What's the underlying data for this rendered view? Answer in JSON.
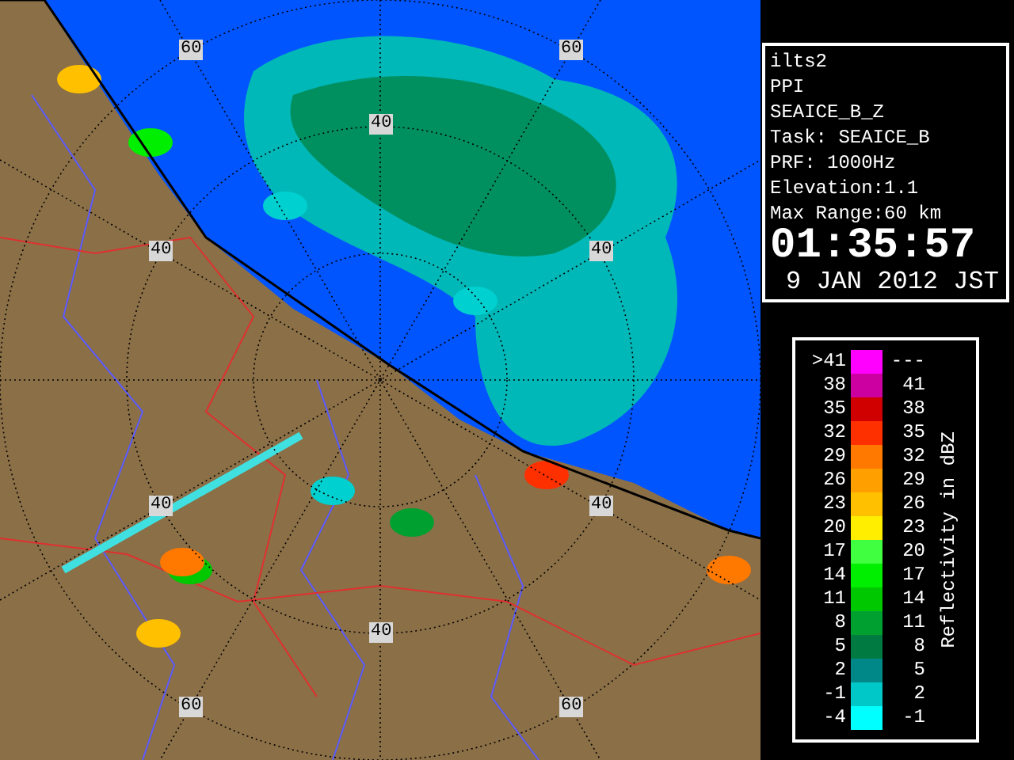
{
  "map": {
    "ring_labels": [
      "60",
      "60",
      "40",
      "40",
      "40",
      "40",
      "40",
      "40",
      "60",
      "60"
    ]
  },
  "info": {
    "lines": [
      "ilts2",
      "PPI",
      "SEAICE_B_Z",
      "Task: SEAICE_B",
      "PRF: 1000Hz",
      "Elevation:1.1",
      "Max Range:60 km"
    ],
    "time": "01:35:57",
    "date": "9 JAN 2012 JST"
  },
  "legend": {
    "title": "Reflectivity in dBZ",
    "bands": [
      {
        "low": ">41",
        "high": "---",
        "color": "#ff00ff"
      },
      {
        "low": "38",
        "high": "41",
        "color": "#cc00a0"
      },
      {
        "low": "35",
        "high": "38",
        "color": "#d00000"
      },
      {
        "low": "32",
        "high": "35",
        "color": "#ff3000"
      },
      {
        "low": "29",
        "high": "32",
        "color": "#ff7800"
      },
      {
        "low": "26",
        "high": "29",
        "color": "#ffa000"
      },
      {
        "low": "23",
        "high": "26",
        "color": "#ffc000"
      },
      {
        "low": "20",
        "high": "23",
        "color": "#ffee00"
      },
      {
        "low": "17",
        "high": "20",
        "color": "#40ff40"
      },
      {
        "low": "14",
        "high": "17",
        "color": "#00ee00"
      },
      {
        "low": "11",
        "high": "14",
        "color": "#00c800"
      },
      {
        "low": "8",
        "high": "11",
        "color": "#00a030"
      },
      {
        "low": "5",
        "high": "8",
        "color": "#007a40"
      },
      {
        "low": "2",
        "high": "5",
        "color": "#008888"
      },
      {
        "low": "-1",
        "high": "2",
        "color": "#00c8c8"
      },
      {
        "low": "-4",
        "high": "-1",
        "color": "#00ffff"
      }
    ]
  }
}
